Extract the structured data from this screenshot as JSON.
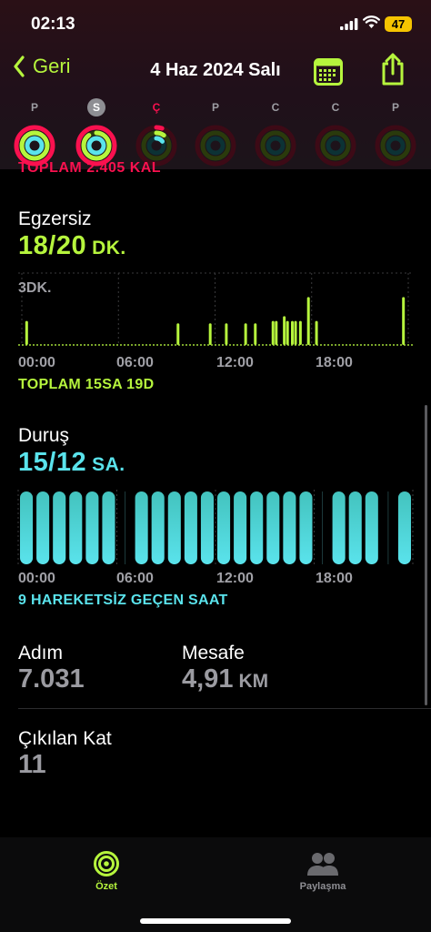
{
  "status_bar": {
    "time": "02:13",
    "battery": "47"
  },
  "nav": {
    "back_label": "Geri",
    "title": "4 Haz 2024 Salı"
  },
  "week": {
    "days": [
      {
        "letter": "P",
        "state": "past",
        "move": 1.0,
        "exercise": 1.0,
        "stand": 1.0
      },
      {
        "letter": "S",
        "state": "selected",
        "move": 1.0,
        "exercise": 0.9,
        "stand": 1.0
      },
      {
        "letter": "Ç",
        "state": "today",
        "move": 0.05,
        "exercise": 0.1,
        "stand": 0.15
      },
      {
        "letter": "P",
        "state": "future",
        "move": 0,
        "exercise": 0,
        "stand": 0
      },
      {
        "letter": "C",
        "state": "future",
        "move": 0,
        "exercise": 0,
        "stand": 0
      },
      {
        "letter": "C",
        "state": "future",
        "move": 0,
        "exercise": 0,
        "stand": 0
      },
      {
        "letter": "P",
        "state": "future",
        "move": 0,
        "exercise": 0,
        "stand": 0
      }
    ]
  },
  "move": {
    "total": "TOPLAM 2.405 KAL"
  },
  "exercise": {
    "title": "Egzersiz",
    "value": "18/20",
    "unit": "DK.",
    "scale_label": "3DK.",
    "total": "TOPLAM 15SA 19D",
    "axis": [
      "00:00",
      "06:00",
      "12:00",
      "18:00"
    ],
    "color": "#b6f53d"
  },
  "stand": {
    "title": "Duruş",
    "value": "15/12",
    "unit": "SA.",
    "total": "9 HAREKETSİZ GEÇEN SAAT",
    "axis": [
      "00:00",
      "06:00",
      "12:00",
      "18:00"
    ],
    "color": "#5ae3ec"
  },
  "stats": {
    "steps_label": "Adım",
    "steps_value": "7.031",
    "distance_label": "Mesafe",
    "distance_value": "4,91",
    "distance_unit": "KM",
    "floors_label": "Çıkılan Kat",
    "floors_value": "11"
  },
  "tabbar": {
    "summary_label": "Özet",
    "sharing_label": "Paylaşma"
  },
  "chart_data": [
    {
      "type": "bar",
      "title": "Egzersiz",
      "unit": "DK.",
      "x_range_hours": [
        0,
        24
      ],
      "ylim": [
        0,
        3
      ],
      "tick_labels": [
        "00:00",
        "06:00",
        "12:00",
        "18:00"
      ],
      "scale_label": "3DK.",
      "bars": [
        {
          "hour": 0.3,
          "minutes": 1.0
        },
        {
          "hour": 9.7,
          "minutes": 0.9
        },
        {
          "hour": 11.7,
          "minutes": 0.9
        },
        {
          "hour": 12.7,
          "minutes": 0.9
        },
        {
          "hour": 13.9,
          "minutes": 0.9
        },
        {
          "hour": 14.5,
          "minutes": 0.9
        },
        {
          "hour": 15.6,
          "minutes": 1.0
        },
        {
          "hour": 15.8,
          "minutes": 1.0
        },
        {
          "hour": 16.3,
          "minutes": 1.2
        },
        {
          "hour": 16.5,
          "minutes": 1.0
        },
        {
          "hour": 16.8,
          "minutes": 1.0
        },
        {
          "hour": 17.0,
          "minutes": 1.0
        },
        {
          "hour": 17.3,
          "minutes": 1.0
        },
        {
          "hour": 17.8,
          "minutes": 2.0
        },
        {
          "hour": 18.3,
          "minutes": 1.0
        },
        {
          "hour": 23.7,
          "minutes": 2.0
        }
      ]
    },
    {
      "type": "bar",
      "title": "Duruş",
      "unit": "SA.",
      "categories": [
        "00",
        "01",
        "02",
        "03",
        "04",
        "05",
        "06",
        "07",
        "08",
        "09",
        "10",
        "11",
        "12",
        "13",
        "14",
        "15",
        "16",
        "17",
        "18",
        "19",
        "20",
        "21",
        "22",
        "23"
      ],
      "stood": [
        true,
        true,
        true,
        true,
        true,
        true,
        false,
        true,
        true,
        true,
        true,
        true,
        true,
        true,
        true,
        true,
        true,
        true,
        false,
        true,
        true,
        true,
        false,
        true
      ],
      "tick_labels": [
        "00:00",
        "06:00",
        "12:00",
        "18:00"
      ]
    }
  ]
}
